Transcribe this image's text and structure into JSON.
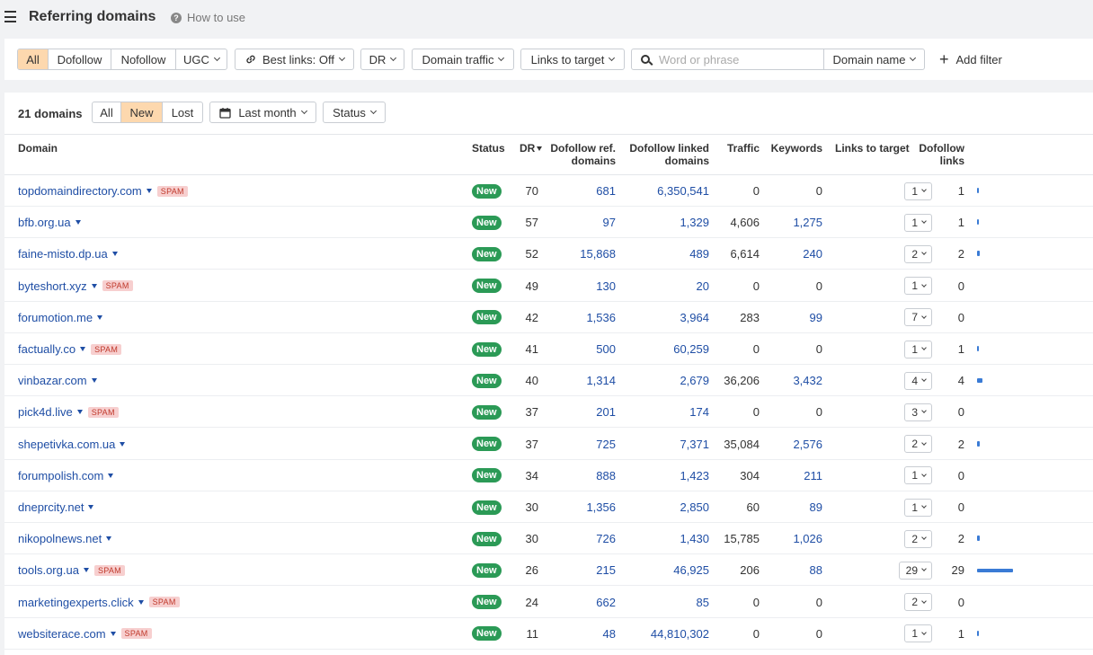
{
  "header": {
    "title": "Referring domains",
    "how_to_use": "How to use"
  },
  "filters": {
    "link_type": [
      "All",
      "Dofollow",
      "Nofollow",
      "UGC"
    ],
    "link_type_active": "All",
    "best_links": "Best links: Off",
    "dr": "DR",
    "domain_traffic": "Domain traffic",
    "links_to_target": "Links to target",
    "search_placeholder": "Word or phrase",
    "search_scope": "Domain name",
    "add_filter": "Add filter"
  },
  "table_toolbar": {
    "count": "21 domains",
    "tabs": [
      "All",
      "New",
      "Lost"
    ],
    "active_tab": "New",
    "period": "Last month",
    "status": "Status"
  },
  "columns": {
    "domain": "Domain",
    "status": "Status",
    "dr": "DR",
    "dofollow_ref_domains": [
      "Dofollow ref.",
      "domains"
    ],
    "dofollow_linked_domains": [
      "Dofollow linked",
      "domains"
    ],
    "traffic": "Traffic",
    "keywords": "Keywords",
    "links_to_target": "Links to target",
    "dofollow_links": [
      "Dofollow",
      "links"
    ]
  },
  "rows": [
    {
      "domain": "topdomaindirectory.com",
      "spam": true,
      "status": "New",
      "dr": "70",
      "ref": "681",
      "linked": "6,350,541",
      "traffic": "0",
      "keywords": "0",
      "ltt": "1",
      "dofollow": "1",
      "bar": 1
    },
    {
      "domain": "bfb.org.ua",
      "spam": false,
      "status": "New",
      "dr": "57",
      "ref": "97",
      "linked": "1,329",
      "traffic": "4,606",
      "keywords": "1,275",
      "ltt": "1",
      "dofollow": "1",
      "bar": 1
    },
    {
      "domain": "faine-misto.dp.ua",
      "spam": false,
      "status": "New",
      "dr": "52",
      "ref": "15,868",
      "linked": "489",
      "traffic": "6,614",
      "keywords": "240",
      "ltt": "2",
      "dofollow": "2",
      "bar": 2
    },
    {
      "domain": "byteshort.xyz",
      "spam": true,
      "status": "New",
      "dr": "49",
      "ref": "130",
      "linked": "20",
      "traffic": "0",
      "keywords": "0",
      "ltt": "1",
      "dofollow": "0",
      "bar": 0
    },
    {
      "domain": "forumotion.me",
      "spam": false,
      "status": "New",
      "dr": "42",
      "ref": "1,536",
      "linked": "3,964",
      "traffic": "283",
      "keywords": "99",
      "ltt": "7",
      "dofollow": "0",
      "bar": 0
    },
    {
      "domain": "factually.co",
      "spam": true,
      "status": "New",
      "dr": "41",
      "ref": "500",
      "linked": "60,259",
      "traffic": "0",
      "keywords": "0",
      "ltt": "1",
      "dofollow": "1",
      "bar": 1
    },
    {
      "domain": "vinbazar.com",
      "spam": false,
      "status": "New",
      "dr": "40",
      "ref": "1,314",
      "linked": "2,679",
      "traffic": "36,206",
      "keywords": "3,432",
      "ltt": "4",
      "dofollow": "4",
      "bar": 4
    },
    {
      "domain": "pick4d.live",
      "spam": true,
      "status": "New",
      "dr": "37",
      "ref": "201",
      "linked": "174",
      "traffic": "0",
      "keywords": "0",
      "ltt": "3",
      "dofollow": "0",
      "bar": 0
    },
    {
      "domain": "shepetivka.com.ua",
      "spam": false,
      "status": "New",
      "dr": "37",
      "ref": "725",
      "linked": "7,371",
      "traffic": "35,084",
      "keywords": "2,576",
      "ltt": "2",
      "dofollow": "2",
      "bar": 2
    },
    {
      "domain": "forumpolish.com",
      "spam": false,
      "status": "New",
      "dr": "34",
      "ref": "888",
      "linked": "1,423",
      "traffic": "304",
      "keywords": "211",
      "ltt": "1",
      "dofollow": "0",
      "bar": 0
    },
    {
      "domain": "dneprcity.net",
      "spam": false,
      "status": "New",
      "dr": "30",
      "ref": "1,356",
      "linked": "2,850",
      "traffic": "60",
      "keywords": "89",
      "ltt": "1",
      "dofollow": "0",
      "bar": 0
    },
    {
      "domain": "nikopolnews.net",
      "spam": false,
      "status": "New",
      "dr": "30",
      "ref": "726",
      "linked": "1,430",
      "traffic": "15,785",
      "keywords": "1,026",
      "ltt": "2",
      "dofollow": "2",
      "bar": 2
    },
    {
      "domain": "tools.org.ua",
      "spam": true,
      "status": "New",
      "dr": "26",
      "ref": "215",
      "linked": "46,925",
      "traffic": "206",
      "keywords": "88",
      "ltt": "29",
      "dofollow": "29",
      "bar": 29
    },
    {
      "domain": "marketingexperts.click",
      "spam": true,
      "status": "New",
      "dr": "24",
      "ref": "662",
      "linked": "85",
      "traffic": "0",
      "keywords": "0",
      "ltt": "2",
      "dofollow": "0",
      "bar": 0
    },
    {
      "domain": "websiterace.com",
      "spam": true,
      "status": "New",
      "dr": "11",
      "ref": "48",
      "linked": "44,810,302",
      "traffic": "0",
      "keywords": "0",
      "ltt": "1",
      "dofollow": "1",
      "bar": 1
    }
  ],
  "spam_label": "SPAM",
  "colors": {
    "accent": "#fdd8ae",
    "link": "#1f4ea5",
    "new_badge": "#2b9a56",
    "bar": "#3a7bd5",
    "spam_bg": "#f7cfcf"
  }
}
